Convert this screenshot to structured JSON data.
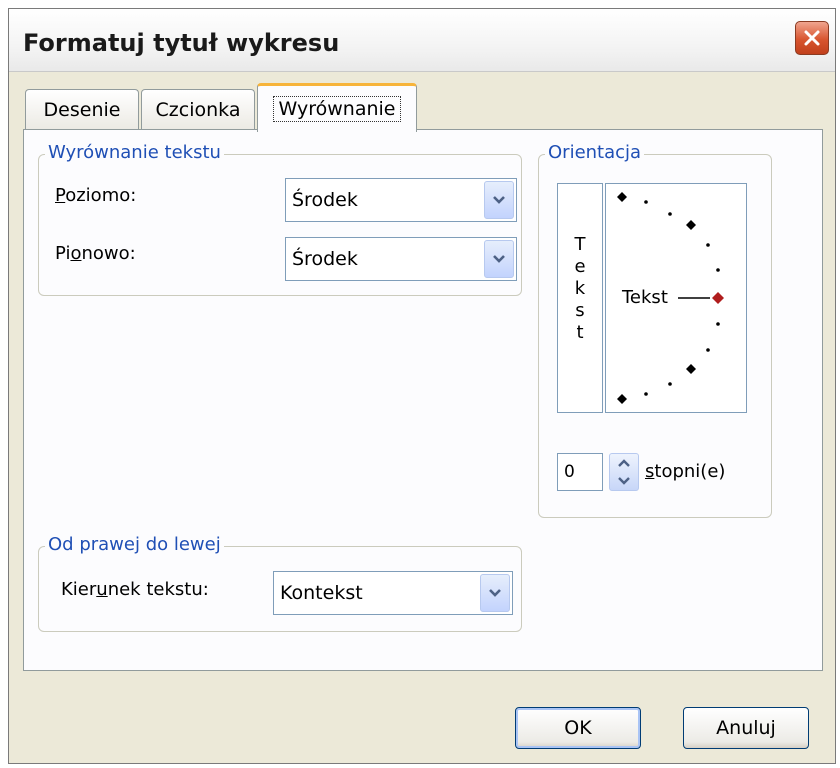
{
  "window": {
    "title": "Formatuj tytuł wykresu"
  },
  "tabs": [
    {
      "label": "Desenie"
    },
    {
      "label": "Czcionka"
    },
    {
      "label": "Wyrównanie",
      "active": true
    }
  ],
  "alignment_group": {
    "legend": "Wyrównanie tekstu",
    "horizontal": {
      "label_pre": "",
      "label_u": "P",
      "label_post": "oziomo:",
      "value": "Środek"
    },
    "vertical": {
      "label_pre": "Pi",
      "label_u": "o",
      "label_post": "nowo:",
      "value": "Środek"
    }
  },
  "orientation_group": {
    "legend": "Orientacja",
    "vertical_text_letters": [
      "T",
      "e",
      "k",
      "s",
      "t"
    ],
    "dial_text": "Tekst",
    "degrees_value": "0",
    "degrees_label_u": "s",
    "degrees_label_post": "topni(e)"
  },
  "rtl_group": {
    "legend": "Od prawej do lewej",
    "direction": {
      "label_pre": "Kier",
      "label_u": "u",
      "label_post": "nek tekstu:",
      "value": "Kontekst"
    }
  },
  "buttons": {
    "ok": "OK",
    "cancel": "Anuluj"
  },
  "icons": {
    "close": "close-x-icon",
    "dropdown": "chevron-down-icon",
    "spin_up": "arrow-up-icon",
    "spin_down": "arrow-down-icon"
  },
  "colors": {
    "accent": "#1f4fb5",
    "close": "#d8552f",
    "tab_highlight": "#f7b43a",
    "dial_active": "#b01d1d"
  }
}
